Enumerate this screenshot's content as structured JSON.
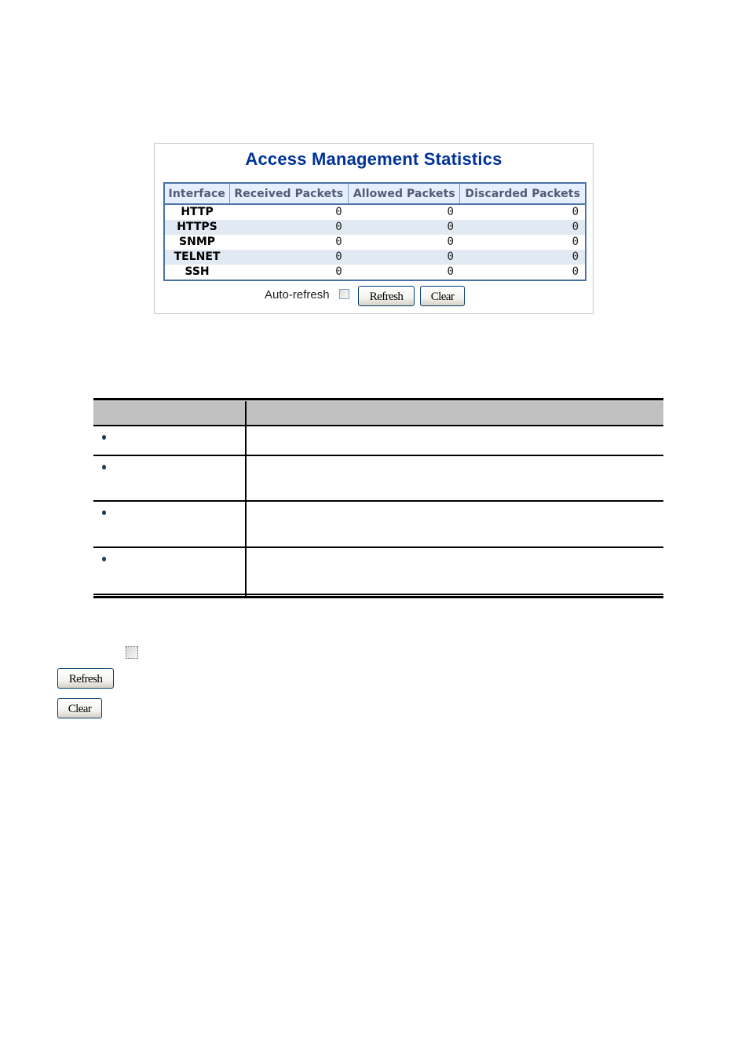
{
  "panel": {
    "title": "Access Management Statistics",
    "columns": [
      "Interface",
      "Received Packets",
      "Allowed Packets",
      "Discarded Packets"
    ],
    "rows": [
      {
        "interface": "HTTP",
        "received": "0",
        "allowed": "0",
        "discarded": "0"
      },
      {
        "interface": "HTTPS",
        "received": "0",
        "allowed": "0",
        "discarded": "0"
      },
      {
        "interface": "SNMP",
        "received": "0",
        "allowed": "0",
        "discarded": "0"
      },
      {
        "interface": "TELNET",
        "received": "0",
        "allowed": "0",
        "discarded": "0"
      },
      {
        "interface": "SSH",
        "received": "0",
        "allowed": "0",
        "discarded": "0"
      }
    ],
    "controls": {
      "auto_refresh_label": "Auto-refresh",
      "auto_refresh_checked": false,
      "refresh_label": "Refresh",
      "clear_label": "Clear"
    }
  },
  "doc_table": {
    "bullet_rows": 4
  },
  "legend": {
    "refresh_label": "Refresh",
    "clear_label": "Clear"
  },
  "colors": {
    "title": "#003399",
    "header_bg": "#e6efff",
    "header_text": "#4e5d75",
    "table_border": "#4a72a6",
    "stripe": "#e1e9f2",
    "doc_header_bg": "#c0c0c0"
  }
}
